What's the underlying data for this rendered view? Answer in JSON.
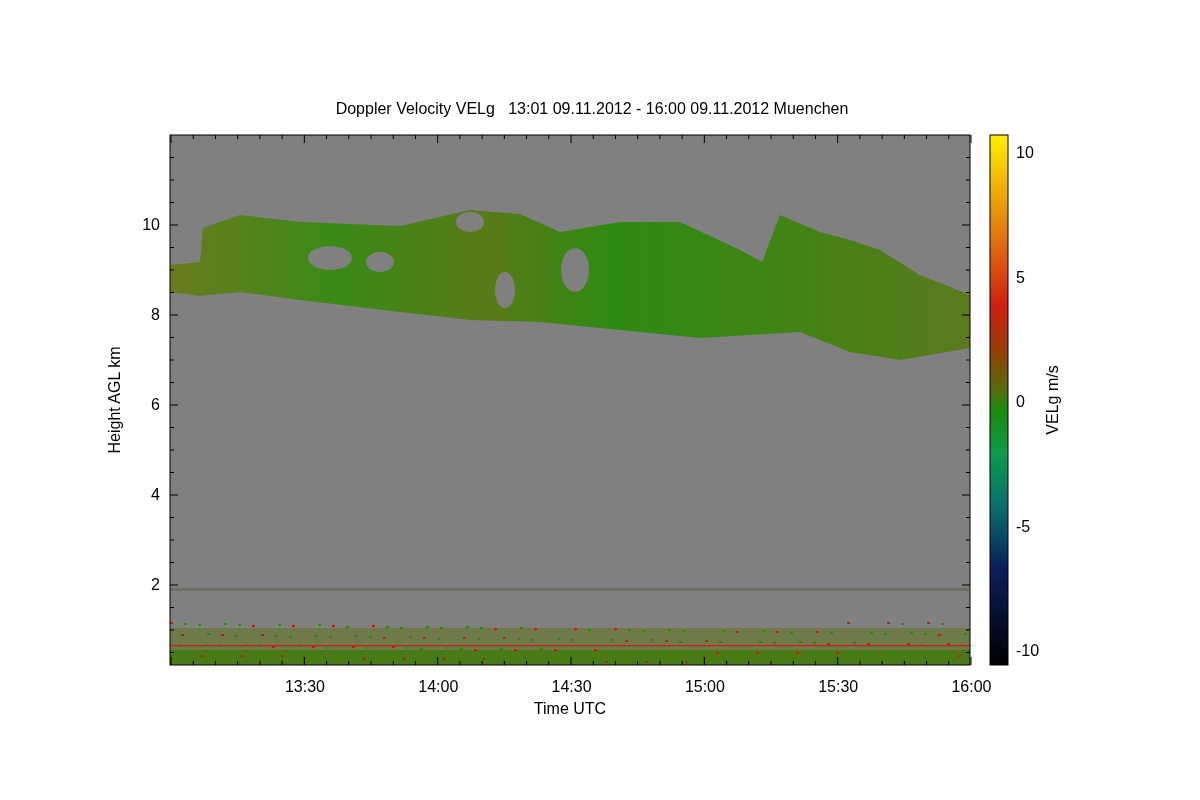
{
  "title": "Doppler Velocity VELg   13:01 09.11.2012 - 16:00 09.11.2012 Muenchen",
  "x_axis": {
    "label": "Time UTC",
    "ticks": [
      "13:30",
      "14:00",
      "14:30",
      "15:00",
      "15:30",
      "16:00"
    ]
  },
  "y_axis": {
    "label": "Height AGL km",
    "ticks": [
      "10",
      "8",
      "6",
      "4",
      "2"
    ]
  },
  "colorbar": {
    "label": "VELg m/s",
    "ticks": [
      "10",
      "5",
      "0",
      "-5",
      "-10"
    ]
  }
}
